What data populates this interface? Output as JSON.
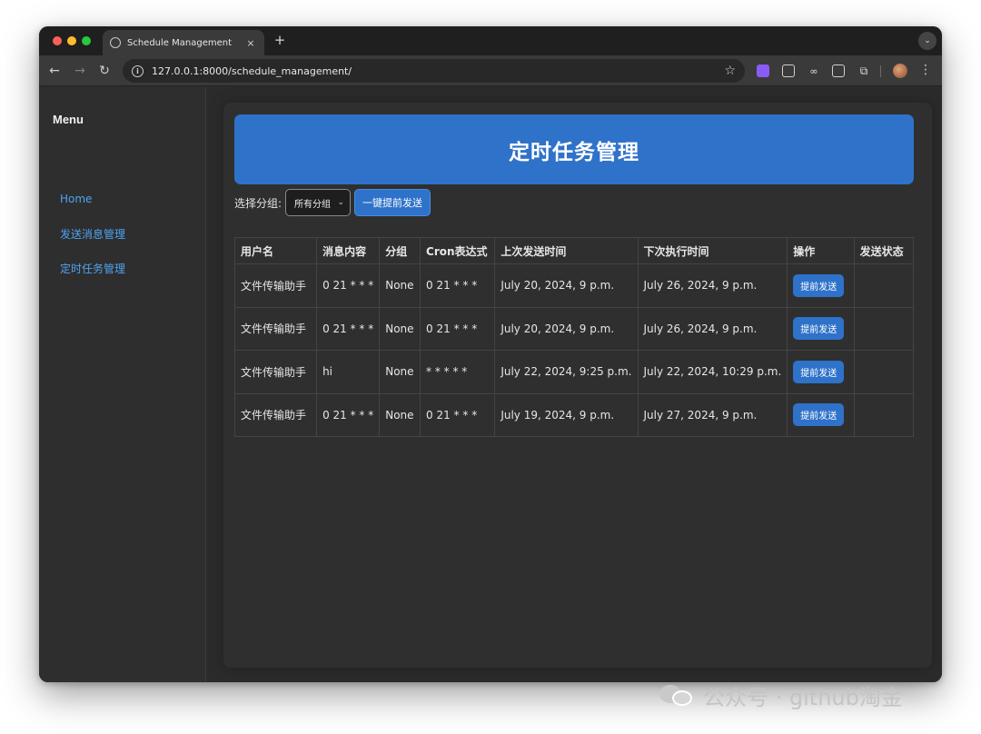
{
  "browser": {
    "tab_title": "Schedule Management",
    "tab_close": "×",
    "new_tab": "+",
    "url": "127.0.0.1:8000/schedule_management/"
  },
  "sidebar": {
    "title": "Menu",
    "items": [
      {
        "label": "Home"
      },
      {
        "label": "发送消息管理"
      },
      {
        "label": "定时任务管理"
      }
    ]
  },
  "main": {
    "title": "定时任务管理",
    "filter_label": "选择分组:",
    "group_select_value": "所有分组",
    "bulk_send_button": "一键提前发送"
  },
  "table": {
    "headers": [
      "用户名",
      "消息内容",
      "分组",
      "Cron表达式",
      "上次发送时间",
      "下次执行时间",
      "操作",
      "发送状态"
    ],
    "rows": [
      {
        "user": "文件传输助手",
        "message": "0 21 * * *",
        "group": "None",
        "cron": "0 21 * * *",
        "last_sent": "July 20, 2024, 9 p.m.",
        "next_run": "July 26, 2024, 9 p.m.",
        "action": "提前发送",
        "status": ""
      },
      {
        "user": "文件传输助手",
        "message": "0 21 * * *",
        "group": "None",
        "cron": "0 21 * * *",
        "last_sent": "July 20, 2024, 9 p.m.",
        "next_run": "July 26, 2024, 9 p.m.",
        "action": "提前发送",
        "status": ""
      },
      {
        "user": "文件传输助手",
        "message": "hi",
        "group": "None",
        "cron": "* * * * *",
        "last_sent": "July 22, 2024, 9:25 p.m.",
        "next_run": "July 22, 2024, 10:29 p.m.",
        "action": "提前发送",
        "status": ""
      },
      {
        "user": "文件传输助手",
        "message": "0 21 * * *",
        "group": "None",
        "cron": "0 21 * * *",
        "last_sent": "July 19, 2024, 9 p.m.",
        "next_run": "July 27, 2024, 9 p.m.",
        "action": "提前发送",
        "status": ""
      }
    ]
  },
  "watermark": {
    "text": "公众号 · github淘金"
  },
  "colors": {
    "accent": "#2f72c9",
    "link": "#4ea3f2",
    "background": "#2b2b2b"
  }
}
